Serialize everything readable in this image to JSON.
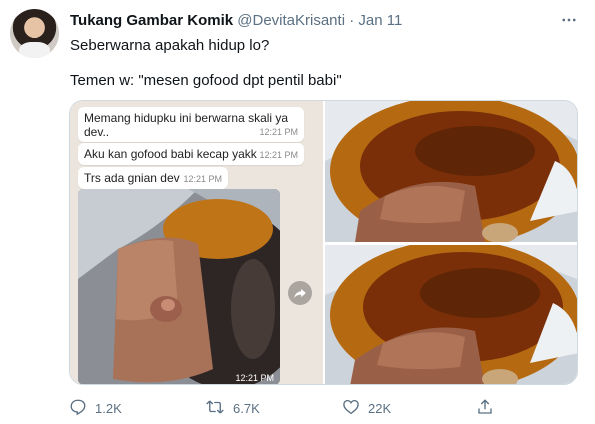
{
  "author": {
    "name": "Tukang Gambar Komik",
    "handle": "@DevitaKrisanti",
    "separator": "·",
    "date": "Jan 11"
  },
  "tweet_lines": [
    "Seberwarna apakah hidup lo?",
    "Temen w: \"mesen gofood dpt pentil babi\""
  ],
  "chat": {
    "messages": [
      {
        "text_line1": "Memang hidupku ini berwarna skali ya",
        "text_line2": "dev..",
        "time": "12:21 PM"
      },
      {
        "text": "Aku kan gofood babi kecap yakk",
        "time": "12:21 PM"
      },
      {
        "text": "Trs ada gnian dev",
        "time": "12:21 PM"
      }
    ],
    "photo_time": "12:21 PM"
  },
  "actions": {
    "reply_count": "1.2K",
    "retweet_count": "6.7K",
    "like_count": "22K"
  },
  "icons": [
    "more-icon",
    "reply-icon",
    "retweet-icon",
    "like-icon",
    "share-icon",
    "forward-icon"
  ],
  "colors": {
    "secondary_text": "#5b7083",
    "border": "#cfd9de",
    "chat_background": "#ece5dd"
  }
}
